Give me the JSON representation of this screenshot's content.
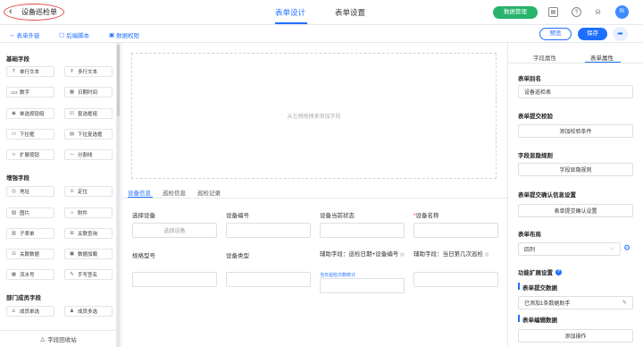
{
  "header": {
    "back_icon": "chevron-left-icon",
    "title": "设备巡检单",
    "tabs": [
      {
        "label": "表单设计",
        "active": true
      },
      {
        "label": "表单设置",
        "active": false
      }
    ],
    "data_manage_label": "数据管理",
    "icons": [
      "bookmark-icon",
      "help-icon",
      "bell-icon"
    ],
    "avatar_text": "Ri",
    "accent_color": "#1e6fff",
    "data_manage_color": "#27b36c"
  },
  "subbar": {
    "items": [
      {
        "icon": "link-icon",
        "label": "表单外链"
      },
      {
        "icon": "script-icon",
        "label": "后端脚本"
      },
      {
        "icon": "permission-icon",
        "label": "数据权限"
      }
    ],
    "preview_label": "预览",
    "save_label": "保存",
    "share_icon": "share-icon"
  },
  "sidebar": {
    "sections": [
      {
        "title": "基础字段",
        "items": [
          {
            "icon": "T",
            "label": "单行文本"
          },
          {
            "icon": "Ŧ",
            "label": "多行文本"
          },
          {
            "icon": "123",
            "label": "数字"
          },
          {
            "icon": "▦",
            "label": "日期时间"
          },
          {
            "icon": "◉",
            "label": "单选按钮组"
          },
          {
            "icon": "☑",
            "label": "复选框组"
          },
          {
            "icon": "▭",
            "label": "下拉框"
          },
          {
            "icon": "▤",
            "label": "下拉复选框"
          },
          {
            "icon": "⊂",
            "label": "扩展按钮"
          },
          {
            "icon": "─",
            "label": "分割线"
          }
        ]
      },
      {
        "title": "增强字段",
        "items": [
          {
            "icon": "◎",
            "label": "地址"
          },
          {
            "icon": "⊙",
            "label": "定位"
          },
          {
            "icon": "▨",
            "label": "图片"
          },
          {
            "icon": "⌂",
            "label": "附件"
          },
          {
            "icon": "▥",
            "label": "子表单"
          },
          {
            "icon": "⊞",
            "label": "关联查询"
          },
          {
            "icon": "⊡",
            "label": "关联数据"
          },
          {
            "icon": "▣",
            "label": "数据加载"
          },
          {
            "icon": "▦",
            "label": "流水号"
          },
          {
            "icon": "✎",
            "label": "手写签名"
          }
        ]
      },
      {
        "title": "部门成员字段",
        "items": [
          {
            "icon": "♙",
            "label": "成员单选"
          },
          {
            "icon": "♟",
            "label": "成员多选"
          }
        ]
      }
    ],
    "footer_label": "字段回收站",
    "footer_icon": "recycle-icon"
  },
  "canvas": {
    "dropzone_text": "从左侧拖拽来添加字段",
    "form_tabs": [
      "设备信息",
      "巡检信息",
      "巡检记录"
    ],
    "fields": [
      {
        "label": "选择设备",
        "value": "选择设备",
        "required": false
      },
      {
        "label": "设备编号",
        "value": "",
        "required": false
      },
      {
        "label": "设备当前状态",
        "value": "",
        "required": false
      },
      {
        "label": "设备名称",
        "value": "",
        "required": true
      },
      {
        "label": "规格型号",
        "value": "",
        "required": false
      },
      {
        "label": "设备类型",
        "value": "",
        "required": false
      },
      {
        "label": "辅助字段：巡检日期+设备编号",
        "value": "",
        "required": false,
        "hint": "当日巡检次数统计"
      },
      {
        "label": "辅助字段：当日第几次巡检",
        "value": "",
        "required": false
      }
    ]
  },
  "rpanel": {
    "tabs": [
      {
        "label": "字段属性",
        "active": false
      },
      {
        "label": "表单属性",
        "active": true
      }
    ],
    "form_alias_label": "表单别名",
    "form_alias_value": "设备巡检表",
    "submit_check_label": "表单提交校验",
    "submit_check_btn": "添加校验条件",
    "visibility_label": "字段显隐规则",
    "visibility_btn": "字段显隐规则",
    "confirm_label": "表单提交确认信息设置",
    "confirm_btn": "表单提交确认设置",
    "layout_label": "表单布局",
    "layout_value": "四列",
    "ext_label": "功能扩展设置",
    "submit_data_label": "表单提交数据",
    "submit_data_value": "已添加1条数据助手",
    "edit_data_label": "表单编辑数据",
    "add_op_label": "添加操作"
  }
}
